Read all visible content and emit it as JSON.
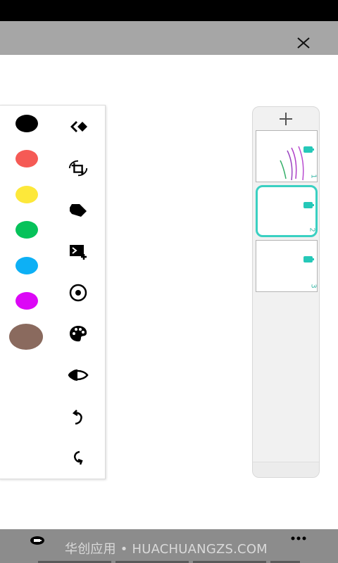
{
  "colors": {
    "top_bar": "#a6a6a6",
    "bottom_bar": "#8c8c8c",
    "selected_page": "#3ad0c2",
    "page_tag": "#25c8b8",
    "swatches": [
      "#000000",
      "#f55a55",
      "#fde83a",
      "#06c25a",
      "#0db0f5",
      "#dc07f6",
      "#8a6a5e"
    ]
  },
  "header": {
    "close_icon": "close-icon"
  },
  "tools": [
    "eraser-icon",
    "crop-rotate-icon",
    "tag-icon",
    "add-slide-icon",
    "target-icon",
    "palette-icon",
    "contrast-icon",
    "undo-icon",
    "redo-icon"
  ],
  "pages": {
    "add_icon": "plus-icon",
    "thumbnails": [
      {
        "number": "1",
        "selected": false
      },
      {
        "number": "2",
        "selected": true
      },
      {
        "number": "3",
        "selected": false
      }
    ]
  },
  "bottom_bar": {
    "watermark": "华创应用 • HUACHUANGZS.COM",
    "left_icon": "battery-icon",
    "right_icon": "more-icon"
  }
}
